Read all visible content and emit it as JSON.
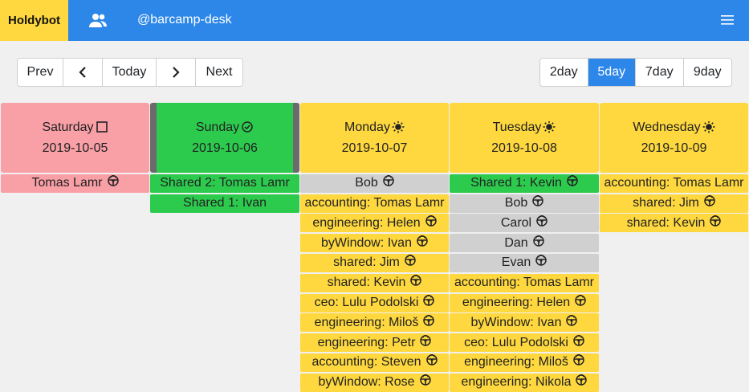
{
  "brand": "Holdybot",
  "account": "@barcamp-desk",
  "nav": {
    "prev": "Prev",
    "today": "Today",
    "next": "Next"
  },
  "views": [
    "2day",
    "5day",
    "7day",
    "9day"
  ],
  "active_view": "5day",
  "colors": {
    "accent": "#2c87e8",
    "brand": "#fed83e",
    "weekend": "#f99fa6",
    "booked": "#2ccb4e",
    "free": "#d0d0d0"
  },
  "days": [
    {
      "name": "Saturday",
      "date": "2019-10-05",
      "status_icon": "square-icon",
      "color": "red",
      "entries": [
        {
          "label": "Tomas Lamr",
          "color": "red"
        }
      ]
    },
    {
      "name": "Sunday",
      "date": "2019-10-06",
      "status_icon": "check-circle-icon",
      "color": "green",
      "entries": [
        {
          "label": "Shared 2: Tomas Lamr",
          "color": "green",
          "noicon": true
        },
        {
          "label": "Shared 1: Ivan",
          "color": "green",
          "noicon": true
        }
      ]
    },
    {
      "name": "Monday",
      "date": "2019-10-07",
      "status_icon": "sun-icon",
      "color": "yellow",
      "entries": [
        {
          "label": "Bob",
          "color": "gray"
        },
        {
          "label": "accounting: Tomas Lamr",
          "color": "yellow",
          "noicon": true
        },
        {
          "label": "engineering: Helen",
          "color": "yellow"
        },
        {
          "label": "byWindow: Ivan",
          "color": "yellow"
        },
        {
          "label": "shared: Jim",
          "color": "yellow"
        },
        {
          "label": "shared: Kevin",
          "color": "yellow"
        },
        {
          "label": "ceo: Lulu Podolski",
          "color": "yellow"
        },
        {
          "label": "engineering: Miloš",
          "color": "yellow"
        },
        {
          "label": "engineering: Petr",
          "color": "yellow"
        },
        {
          "label": "accounting: Steven",
          "color": "yellow"
        },
        {
          "label": "byWindow: Rose",
          "color": "yellow"
        }
      ]
    },
    {
      "name": "Tuesday",
      "date": "2019-10-08",
      "status_icon": "sun-icon",
      "color": "yellow",
      "entries": [
        {
          "label": "Shared 1: Kevin",
          "color": "green"
        },
        {
          "label": "Bob",
          "color": "gray"
        },
        {
          "label": "Carol",
          "color": "gray"
        },
        {
          "label": "Dan",
          "color": "gray"
        },
        {
          "label": "Evan",
          "color": "gray"
        },
        {
          "label": "accounting: Tomas Lamr",
          "color": "yellow",
          "noicon": true
        },
        {
          "label": "engineering: Helen",
          "color": "yellow"
        },
        {
          "label": "byWindow: Ivan",
          "color": "yellow"
        },
        {
          "label": "ceo: Lulu Podolski",
          "color": "yellow"
        },
        {
          "label": "engineering: Miloš",
          "color": "yellow"
        },
        {
          "label": "engineering: Nikola",
          "color": "yellow"
        }
      ]
    },
    {
      "name": "Wednesday",
      "date": "2019-10-09",
      "status_icon": "sun-icon",
      "color": "yellow",
      "entries": [
        {
          "label": "accounting: Tomas Lamr",
          "color": "yellow",
          "noicon": true
        },
        {
          "label": "shared: Jim",
          "color": "yellow"
        },
        {
          "label": "shared: Kevin",
          "color": "yellow"
        }
      ]
    }
  ]
}
